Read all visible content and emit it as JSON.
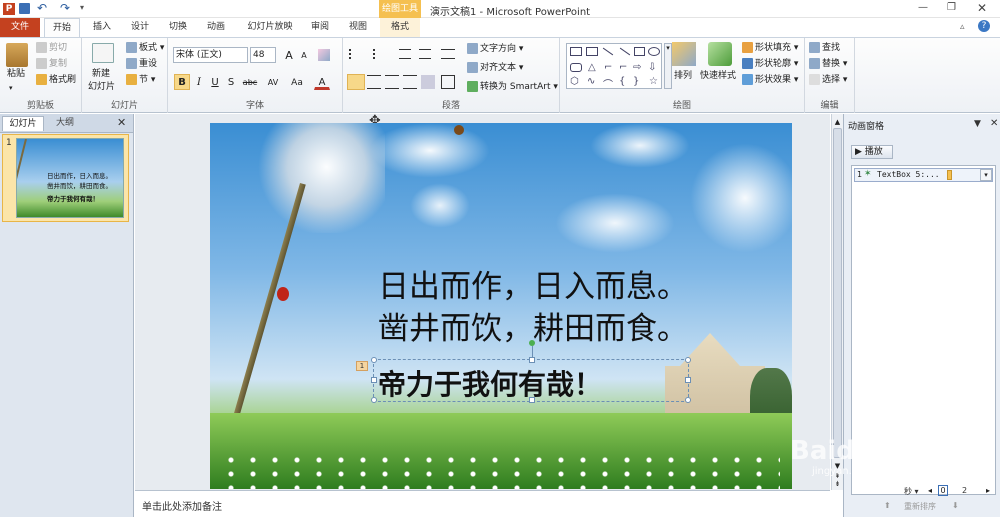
{
  "window": {
    "title": "演示文稿1 - Microsoft PowerPoint",
    "context_tool_group": "绘图工具"
  },
  "quick_access": {
    "undo": "↶",
    "redo": "↷"
  },
  "tabs": [
    "文件",
    "开始",
    "插入",
    "设计",
    "切换",
    "动画",
    "幻灯片放映",
    "审阅",
    "视图",
    "格式"
  ],
  "ribbon": {
    "clipboard": {
      "paste": "粘贴",
      "cut": "剪切",
      "copy": "复制",
      "format_painter": "格式刷",
      "label": "剪贴板"
    },
    "slides": {
      "new_slide": "新建",
      "new_slide2": "幻灯片",
      "layout": "板式",
      "reset": "重设",
      "section": "节",
      "label": "幻灯片"
    },
    "font": {
      "font_name": "宋体 (正文)",
      "font_size": "48",
      "bold": "B",
      "italic": "I",
      "underline": "U",
      "shadow": "S",
      "strike": "abc",
      "spacing": "AV",
      "case": "Aa",
      "color": "A",
      "grow": "A",
      "shrink": "A",
      "label": "字体"
    },
    "paragraph": {
      "text_direction": "文字方向",
      "align_text": "对齐文本",
      "smartart": "转换为 SmartArt",
      "label": "段落"
    },
    "drawing": {
      "arrange": "排列",
      "quick_styles": "快速样式",
      "shape_fill": "形状填充",
      "shape_outline": "形状轮廓",
      "shape_effects": "形状效果",
      "label": "绘图"
    },
    "editing": {
      "find": "查找",
      "replace": "替换",
      "select": "选择",
      "label": "编辑"
    }
  },
  "left_pane": {
    "tab_slides": "幻灯片",
    "tab_outline": "大纲",
    "close": "✕",
    "slide_number": "1",
    "thumb_line1": "日出而作，日入而息。",
    "thumb_line2": "凿井而饮，耕田而食。",
    "thumb_line3": "帝力于我何有哉！"
  },
  "slide": {
    "line1": "日出而作，日入而息。",
    "line2": "凿井而饮，耕田而食。",
    "line3": "帝力于我何有哉！",
    "anim_tag": "1"
  },
  "notes_placeholder": "单击此处添加备注",
  "anim_pane": {
    "title": "动画窗格",
    "play": "播放",
    "item_index": "1",
    "item_label": "TextBox 5:...",
    "seconds": "秒",
    "timeline_0": "0",
    "timeline_2": "2",
    "reorder": "重新排序"
  },
  "watermark": {
    "text": "Baidu经验",
    "url": "jingyan.baidu.com"
  },
  "colors": {
    "file_tab": "#c4411f",
    "context_tab": "#f5c050",
    "selection_dash": "#6b8fb5"
  }
}
